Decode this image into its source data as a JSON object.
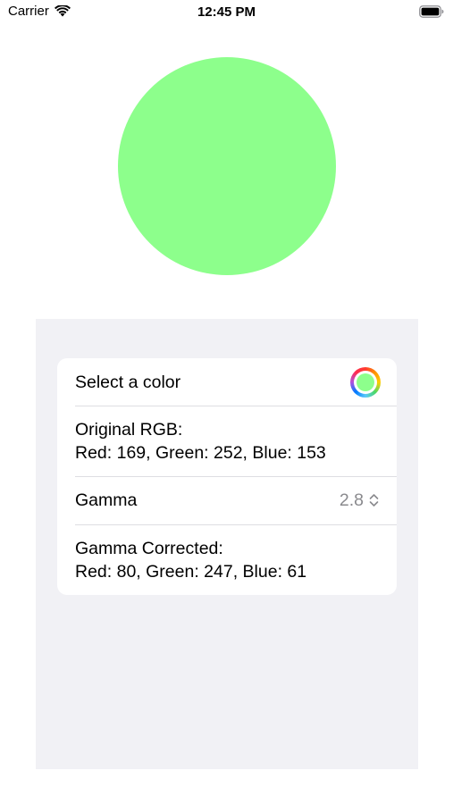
{
  "status_bar": {
    "carrier": "Carrier",
    "time": "12:45 PM",
    "wifi_icon": "wifi-icon",
    "battery_icon": "battery-icon"
  },
  "colors": {
    "selected": "#a9fc99"
  },
  "form": {
    "select_color_label": "Select a color",
    "color_well_icon": "color-wheel-icon",
    "original_title": "Original RGB:",
    "original_values": "Red: 169, Green: 252, Blue: 153",
    "gamma_label": "Gamma",
    "gamma_value": "2.8",
    "gamma_stepper_icon": "chevron-up-down-icon",
    "corrected_title": "Gamma Corrected:",
    "corrected_values": "Red: 80, Green: 247, Blue: 61"
  }
}
